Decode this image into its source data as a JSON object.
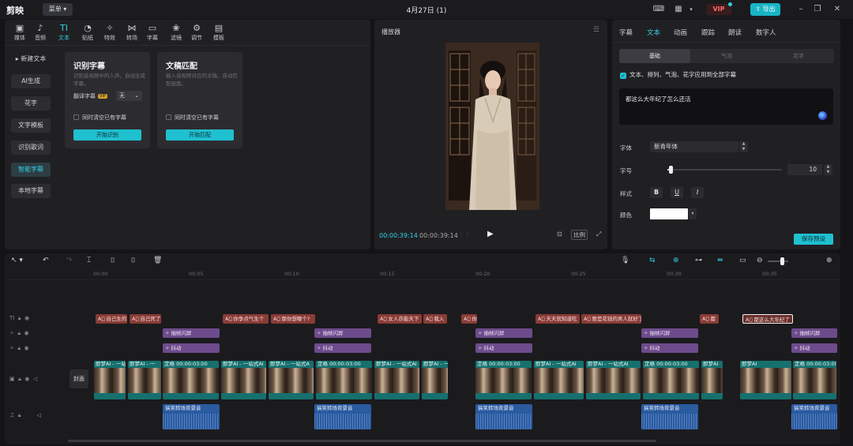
{
  "app": {
    "logo": "剪映",
    "menu": "菜单",
    "title": "4月27日 (1)",
    "vip": "VIP",
    "export": "导出"
  },
  "tool_tabs": [
    {
      "label": "媒体",
      "icon": "▣"
    },
    {
      "label": "音频",
      "icon": "♪"
    },
    {
      "label": "文本",
      "icon": "TI"
    },
    {
      "label": "贴纸",
      "icon": "◔"
    },
    {
      "label": "特效",
      "icon": "✧"
    },
    {
      "label": "转场",
      "icon": "⋈"
    },
    {
      "label": "字幕",
      "icon": "▭"
    },
    {
      "label": "滤镜",
      "icon": "❀"
    },
    {
      "label": "调节",
      "icon": "⚙"
    },
    {
      "label": "模板",
      "icon": "▤"
    }
  ],
  "side_menu": [
    "新建文本",
    "AI生成",
    "花字",
    "文字模板",
    "识别歌词",
    "智能字幕",
    "本地字幕"
  ],
  "cards": [
    {
      "title": "识别字幕",
      "desc": "识别音视频中的人声，自动生成字幕。",
      "row_label": "翻译字幕",
      "row_badge": "VIP",
      "select": "无",
      "check": "同时清空已有字幕",
      "button": "开始识别"
    },
    {
      "title": "文稿匹配",
      "desc": "输入音视频对应的文稿，自动匹配画面。",
      "check": "同时清空已有字幕",
      "button": "开始匹配"
    }
  ],
  "player": {
    "title": "播放器",
    "current": "00:00:39:14",
    "total": "00:00:39:14",
    "ratio": "比例"
  },
  "inspector": {
    "tabs": [
      "字幕",
      "文本",
      "动画",
      "跟踪",
      "朗读",
      "数字人"
    ],
    "segments": [
      "基础",
      "气泡",
      "花字"
    ],
    "apply_all": "文本、排列、气泡、花字应用到全部字幕",
    "text": "都这么大年纪了怎么还活",
    "font_label": "字体",
    "font": "新青年体",
    "size_label": "字号",
    "size": "10",
    "size_slider": 0.03,
    "style_label": "样式",
    "styles": [
      "B",
      "U",
      "I"
    ],
    "color_label": "颜色",
    "color": "#ffffff",
    "save": "保存预设"
  },
  "timeline": {
    "ruler": [
      "00:00",
      "00:05",
      "00:10",
      "00:15",
      "00:20",
      "00:25",
      "00:30",
      "00:35"
    ],
    "cover": "封面",
    "text_clips": [
      "自己生的",
      "自己死了",
      "你争点气生个",
      "那你想哪个?",
      "女人亦能天下",
      "我入",
      "你还",
      "天天就知道吃",
      "要是花钱的男人就好了",
      "都",
      "都这么大年纪了"
    ],
    "fx1_label": "抽帧闪屏",
    "fx2_label": "抖动",
    "video_clips": [
      "即梦AI - 一站式",
      "即梦AI - 一",
      "定格  00:00:03:00",
      "即梦AI - 一站式AI",
      "即梦AI - 一站式A",
      "定格  00:00:03:00",
      "即梦AI - 一站式AI",
      "即梦AI - 一站",
      "定格  00:00:03:00",
      "即梦AI - 一站式AI",
      "即梦AI - 一站式AI",
      "定格  00:00:03:00",
      "即梦AI",
      "即梦AI",
      "定格  00:00:03:00"
    ],
    "audio_label": "搞笑转场背景音"
  }
}
